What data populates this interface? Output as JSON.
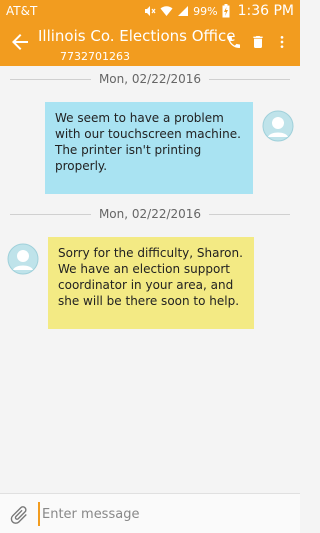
{
  "status_bar": {
    "carrier": "AT&T",
    "battery": "99%",
    "time": "1:36 PM"
  },
  "header": {
    "title": "Illinois Co. Elections Office",
    "phone": "7732701263",
    "icons": [
      "back-arrow-icon",
      "phone-icon",
      "trash-icon",
      "more-vert-icon"
    ]
  },
  "messages": [
    {
      "date": "Mon, 02/22/2016",
      "direction": "outgoing",
      "text": "We seem to have a problem with our touchscreen machine. The printer isn't printing properly."
    },
    {
      "date": "Mon, 02/22/2016",
      "direction": "incoming",
      "text": "Sorry for the difficulty, Sharon. We have an election support coordinator in your area, and she will be there soon to help."
    }
  ],
  "composer": {
    "placeholder": "Enter message"
  },
  "colors": {
    "accent": "#f29c1f",
    "outgoing_bubble": "#a9e3f2",
    "incoming_bubble": "#f3ea84",
    "background": "#f4f4f4"
  }
}
